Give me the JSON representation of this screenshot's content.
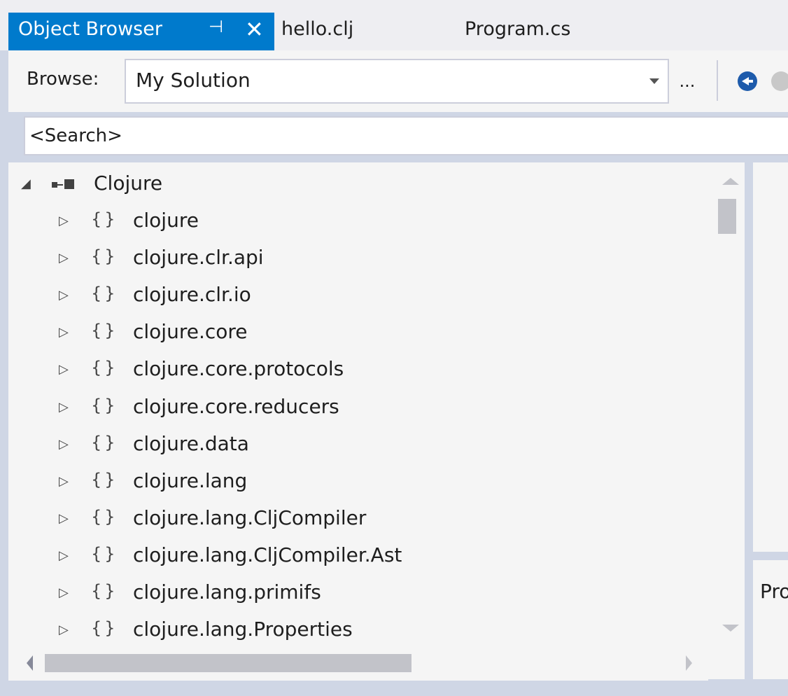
{
  "tabs": {
    "active": {
      "label": "Object Browser",
      "pin_glyph": "⊣",
      "close_glyph": "✕"
    },
    "others": [
      "hello.clj",
      "Program.cs"
    ]
  },
  "toolbar": {
    "browse_label": "Browse:",
    "browse_value": "My Solution",
    "ellipsis": "..."
  },
  "search": {
    "placeholder": "<Search>"
  },
  "tree": {
    "root": {
      "label": "Clojure",
      "expander": "◢"
    },
    "items": [
      "clojure",
      "clojure.clr.api",
      "clojure.clr.io",
      "clojure.core",
      "clojure.core.protocols",
      "clojure.core.reducers",
      "clojure.data",
      "clojure.lang",
      "clojure.lang.CljCompiler",
      "clojure.lang.CljCompiler.Ast",
      "clojure.lang.primifs",
      "clojure.lang.Properties"
    ],
    "item_expander": "▷",
    "namespace_glyph": "{}"
  },
  "description_pane": {
    "text": "Pro"
  },
  "colors": {
    "accent": "#007acc",
    "background": "#cfd6e5",
    "panel": "#f5f5f5"
  }
}
